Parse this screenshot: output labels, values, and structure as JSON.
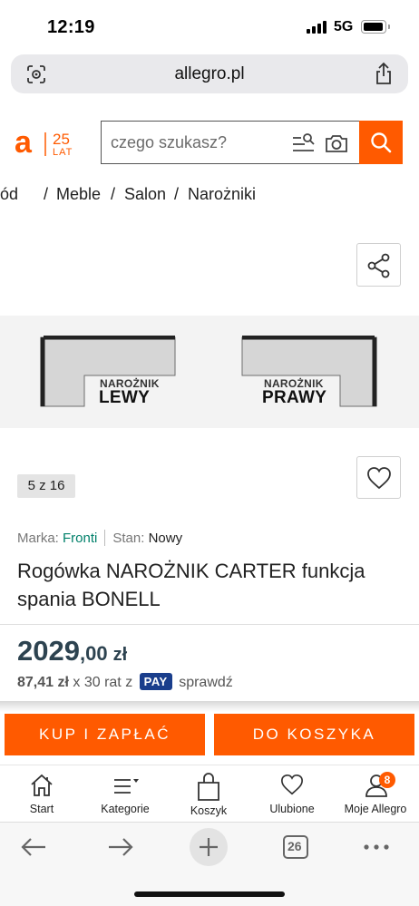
{
  "status_bar": {
    "time": "12:19",
    "network": "5G"
  },
  "browser": {
    "url": "allegro.pl",
    "tabs_count": "26"
  },
  "header": {
    "logo_letter": "a",
    "logo_years": "25",
    "logo_lat": "LAT",
    "search_placeholder": "czego szukasz?",
    "brand_color": "#ff5a00"
  },
  "breadcrumb": [
    "ód",
    "Meble",
    "Salon",
    "Narożniki"
  ],
  "gallery": {
    "left_small": "NAROŻNIK",
    "left_big": "LEWY",
    "right_small": "NAROŻNIK",
    "right_big": "PRAWY",
    "counter": "5 z 16"
  },
  "product": {
    "brand_label": "Marka:",
    "brand_value": "Fronti",
    "state_label": "Stan:",
    "state_value": "Nowy",
    "title": "Rogówka NAROŻNIK CARTER funkcja spania BONELL",
    "price_int": "2029",
    "price_dec": ",00",
    "currency": "zł",
    "installment_amount": "87,41 zł",
    "installment_text": "x 30 rat z",
    "pay_badge": "PAY",
    "check_text": "sprawdź"
  },
  "actions": {
    "buy_label": "KUP I ZAPŁAĆ",
    "cart_label": "DO KOSZYKA"
  },
  "app_nav": [
    {
      "label": "Start",
      "icon": "home-icon"
    },
    {
      "label": "Kategorie",
      "icon": "menu-icon"
    },
    {
      "label": "Koszyk",
      "icon": "basket-icon"
    },
    {
      "label": "Ulubione",
      "icon": "heart-icon"
    },
    {
      "label": "Moje Allegro",
      "icon": "user-icon",
      "badge": "8"
    }
  ]
}
